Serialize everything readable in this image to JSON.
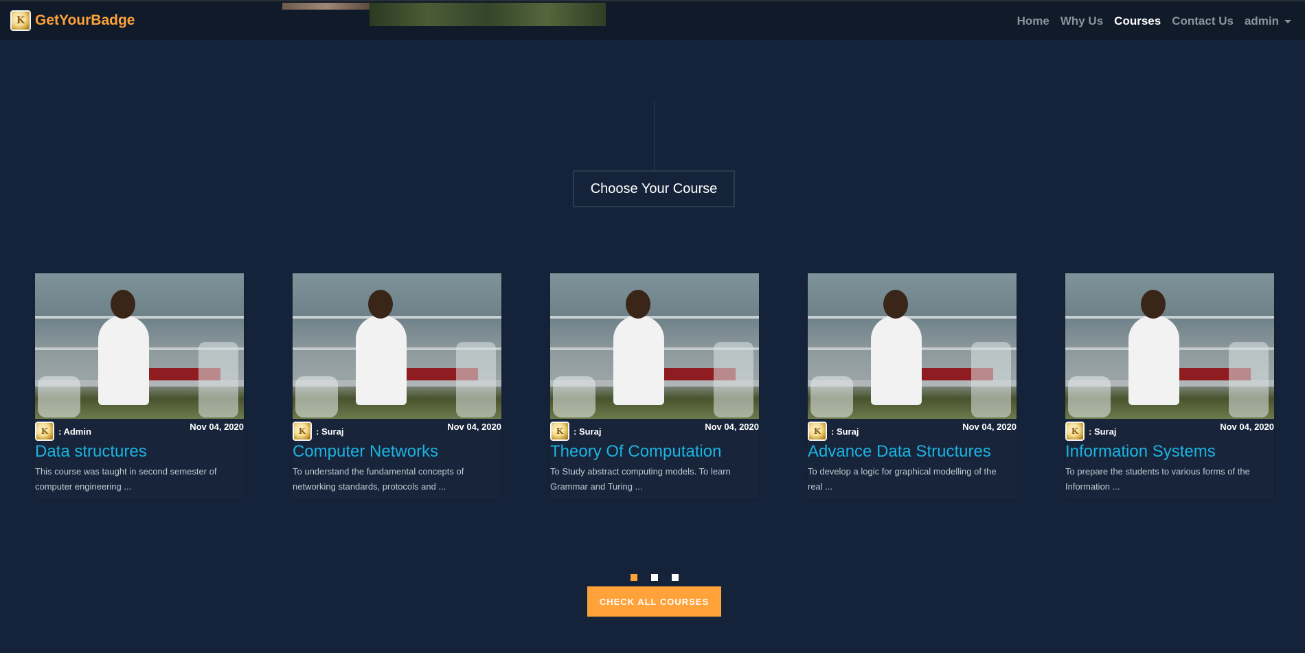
{
  "brand": {
    "name": "GetYourBadge",
    "logo_text": "K"
  },
  "nav": {
    "items": [
      {
        "label": "Home"
      },
      {
        "label": "Why Us"
      },
      {
        "label": "Courses"
      },
      {
        "label": "Contact Us"
      }
    ],
    "user_label": "admin"
  },
  "heading": "Choose Your Course",
  "cards": [
    {
      "author": ": Admin",
      "date": "Nov 04, 2020",
      "title": "Data structures",
      "description": "This course was taught in second semester of computer engineering ..."
    },
    {
      "author": ": Suraj",
      "date": "Nov 04, 2020",
      "title": "Computer Networks",
      "description": "To understand the fundamental concepts of networking standards, protocols and ..."
    },
    {
      "author": ": Suraj",
      "date": "Nov 04, 2020",
      "title": "Theory Of Computation",
      "description": "To Study abstract computing models. To learn Grammar and Turing ..."
    },
    {
      "author": ": Suraj",
      "date": "Nov 04, 2020",
      "title": "Advance Data Structures",
      "description": "To develop a logic for graphical modelling of the real ..."
    },
    {
      "author": ": Suraj",
      "date": "Nov 04, 2020",
      "title": "Information Systems",
      "description": "To prepare the students to various forms of the Information ..."
    }
  ],
  "pagination": {
    "pages": 3,
    "current": 1
  },
  "cta_label": "CHECK ALL COURSES",
  "colors": {
    "accent": "#ffa23a",
    "title": "#1db3e0",
    "background": "#15233a",
    "navbar": "#101a28"
  }
}
